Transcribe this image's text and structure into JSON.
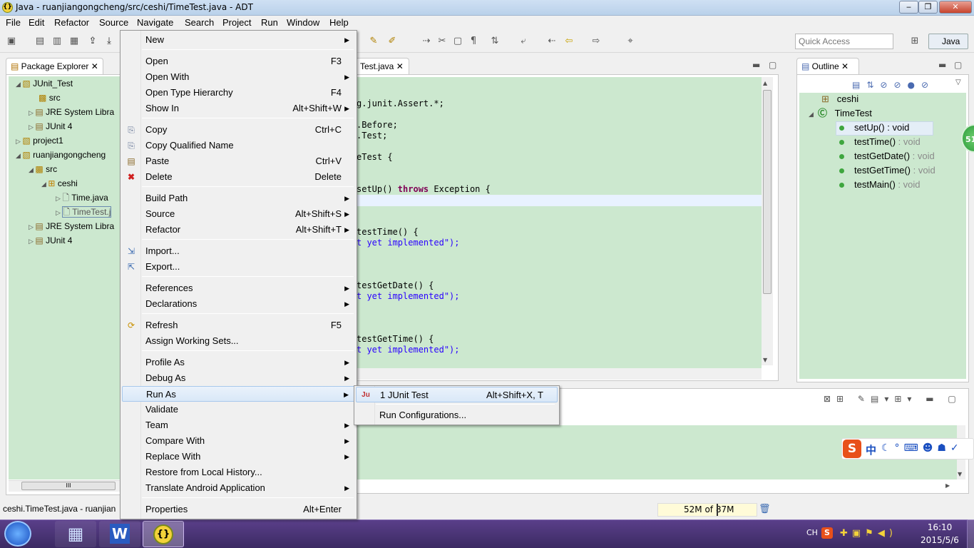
{
  "window": {
    "title": "Java - ruanjiangongcheng/src/ceshi/TimeTest.java - ADT",
    "minimize": "‒",
    "maximize": "❐",
    "close": "✕"
  },
  "menubar": [
    "File",
    "Edit",
    "Refactor",
    "Source",
    "Navigate",
    "Search",
    "Project",
    "Run",
    "Window",
    "Help"
  ],
  "quick_access": {
    "placeholder": "Quick Access"
  },
  "perspective": {
    "label": "Java"
  },
  "package_explorer": {
    "tab": "Package Explorer",
    "rows": [
      {
        "label": "JUnit_Test",
        "icon": "project-icon"
      },
      {
        "label": "src",
        "icon": "source-folder-icon"
      },
      {
        "label": "JRE System Libra",
        "icon": "library-icon"
      },
      {
        "label": "JUnit 4",
        "icon": "library-icon"
      },
      {
        "label": "project1",
        "icon": "project-icon"
      },
      {
        "label": "ruanjiangongcheng",
        "icon": "project-icon"
      },
      {
        "label": "src",
        "icon": "source-folder-icon"
      },
      {
        "label": "ceshi",
        "icon": "package-icon"
      },
      {
        "label": "Time.java",
        "icon": "java-file-icon"
      },
      {
        "label": "TimeTest.j",
        "icon": "java-file-icon"
      },
      {
        "label": "JRE System Libra",
        "icon": "library-icon"
      },
      {
        "label": "JUnit 4",
        "icon": "library-icon"
      }
    ],
    "scroll_thumb": "III"
  },
  "editor": {
    "tab": "Test.java",
    "lines": [
      {
        "text": "g.junit.Assert.*;",
        "kind": "plain"
      },
      {
        "text": ".Before;",
        "kind": "plain"
      },
      {
        "text": ".Test;",
        "kind": "plain"
      },
      {
        "text": "eTest {",
        "kind": "plain"
      },
      {
        "text": "setUp() ",
        "kind": "plain",
        "kw": "throws",
        "rest": " Exception {"
      },
      {
        "text": "testTime() {",
        "kind": "plain"
      },
      {
        "text": "t yet implemented\");",
        "kind": "str"
      },
      {
        "text": "testGetDate() {",
        "kind": "plain"
      },
      {
        "text": "t yet implemented\");",
        "kind": "str"
      },
      {
        "text": "testGetTime() {",
        "kind": "plain"
      },
      {
        "text": "t yet implemented\");",
        "kind": "str"
      }
    ]
  },
  "outline": {
    "tab": "Outline",
    "package": "ceshi",
    "class": "TimeTest",
    "methods": [
      {
        "name": "setUp()",
        "type": " : void"
      },
      {
        "name": "testTime()",
        "type": " : void"
      },
      {
        "name": "testGetDate()",
        "type": " : void"
      },
      {
        "name": "testGetTime()",
        "type": " : void"
      },
      {
        "name": "testMain()",
        "type": " : void"
      }
    ],
    "badge": "51"
  },
  "context_menu": {
    "items": [
      {
        "label": "New",
        "shortcut": "",
        "submenu": true,
        "icon": ""
      },
      {
        "label": "Open",
        "shortcut": "F3",
        "submenu": false,
        "icon": ""
      },
      {
        "label": "Open With",
        "shortcut": "",
        "submenu": true,
        "icon": ""
      },
      {
        "label": "Open Type Hierarchy",
        "shortcut": "F4",
        "submenu": false,
        "icon": ""
      },
      {
        "label": "Show In",
        "shortcut": "Alt+Shift+W",
        "submenu": true,
        "icon": ""
      },
      {
        "label": "Copy",
        "shortcut": "Ctrl+C",
        "submenu": false,
        "icon": "copy-icon"
      },
      {
        "label": "Copy Qualified Name",
        "shortcut": "",
        "submenu": false,
        "icon": "copy-icon"
      },
      {
        "label": "Paste",
        "shortcut": "Ctrl+V",
        "submenu": false,
        "icon": "paste-icon"
      },
      {
        "label": "Delete",
        "shortcut": "Delete",
        "submenu": false,
        "icon": "delete-icon"
      },
      {
        "label": "Build Path",
        "shortcut": "",
        "submenu": true,
        "icon": ""
      },
      {
        "label": "Source",
        "shortcut": "Alt+Shift+S",
        "submenu": true,
        "icon": ""
      },
      {
        "label": "Refactor",
        "shortcut": "Alt+Shift+T",
        "submenu": true,
        "icon": ""
      },
      {
        "label": "Import...",
        "shortcut": "",
        "submenu": false,
        "icon": "import-icon"
      },
      {
        "label": "Export...",
        "shortcut": "",
        "submenu": false,
        "icon": "export-icon"
      },
      {
        "label": "References",
        "shortcut": "",
        "submenu": true,
        "icon": ""
      },
      {
        "label": "Declarations",
        "shortcut": "",
        "submenu": true,
        "icon": ""
      },
      {
        "label": "Refresh",
        "shortcut": "F5",
        "submenu": false,
        "icon": "refresh-icon"
      },
      {
        "label": "Assign Working Sets...",
        "shortcut": "",
        "submenu": false,
        "icon": ""
      },
      {
        "label": "Profile As",
        "shortcut": "",
        "submenu": true,
        "icon": ""
      },
      {
        "label": "Debug As",
        "shortcut": "",
        "submenu": true,
        "icon": ""
      },
      {
        "label": "Run As",
        "shortcut": "",
        "submenu": true,
        "icon": ""
      },
      {
        "label": "Validate",
        "shortcut": "",
        "submenu": false,
        "icon": ""
      },
      {
        "label": "Team",
        "shortcut": "",
        "submenu": true,
        "icon": ""
      },
      {
        "label": "Compare With",
        "shortcut": "",
        "submenu": true,
        "icon": ""
      },
      {
        "label": "Replace With",
        "shortcut": "",
        "submenu": true,
        "icon": ""
      },
      {
        "label": "Restore from Local History...",
        "shortcut": "",
        "submenu": false,
        "icon": ""
      },
      {
        "label": "Translate Android Application",
        "shortcut": "",
        "submenu": true,
        "icon": ""
      },
      {
        "label": "Properties",
        "shortcut": "Alt+Enter",
        "submenu": false,
        "icon": ""
      }
    ]
  },
  "run_as_submenu": {
    "items": [
      {
        "label": "1 JUnit Test",
        "shortcut": "Alt+Shift+X, T",
        "icon": "junit-icon",
        "icon_text": "Ju"
      },
      {
        "label": "Run Configurations...",
        "shortcut": "",
        "icon": ""
      }
    ]
  },
  "statusbar": {
    "left": "ceshi.TimeTest.java - ruanjian",
    "memory": "52M of 87M"
  },
  "ime": {
    "mode": "中",
    "logo": "S"
  },
  "taskbar": {
    "tray_lang": "CH",
    "time": "16:10",
    "date": "2015/5/6",
    "word_label": "W",
    "adt_label": "{}"
  },
  "colors": {
    "editor_bg": "#cce8cf",
    "taskbar": "#3b2a63",
    "highlight": "#d9e8f8"
  }
}
